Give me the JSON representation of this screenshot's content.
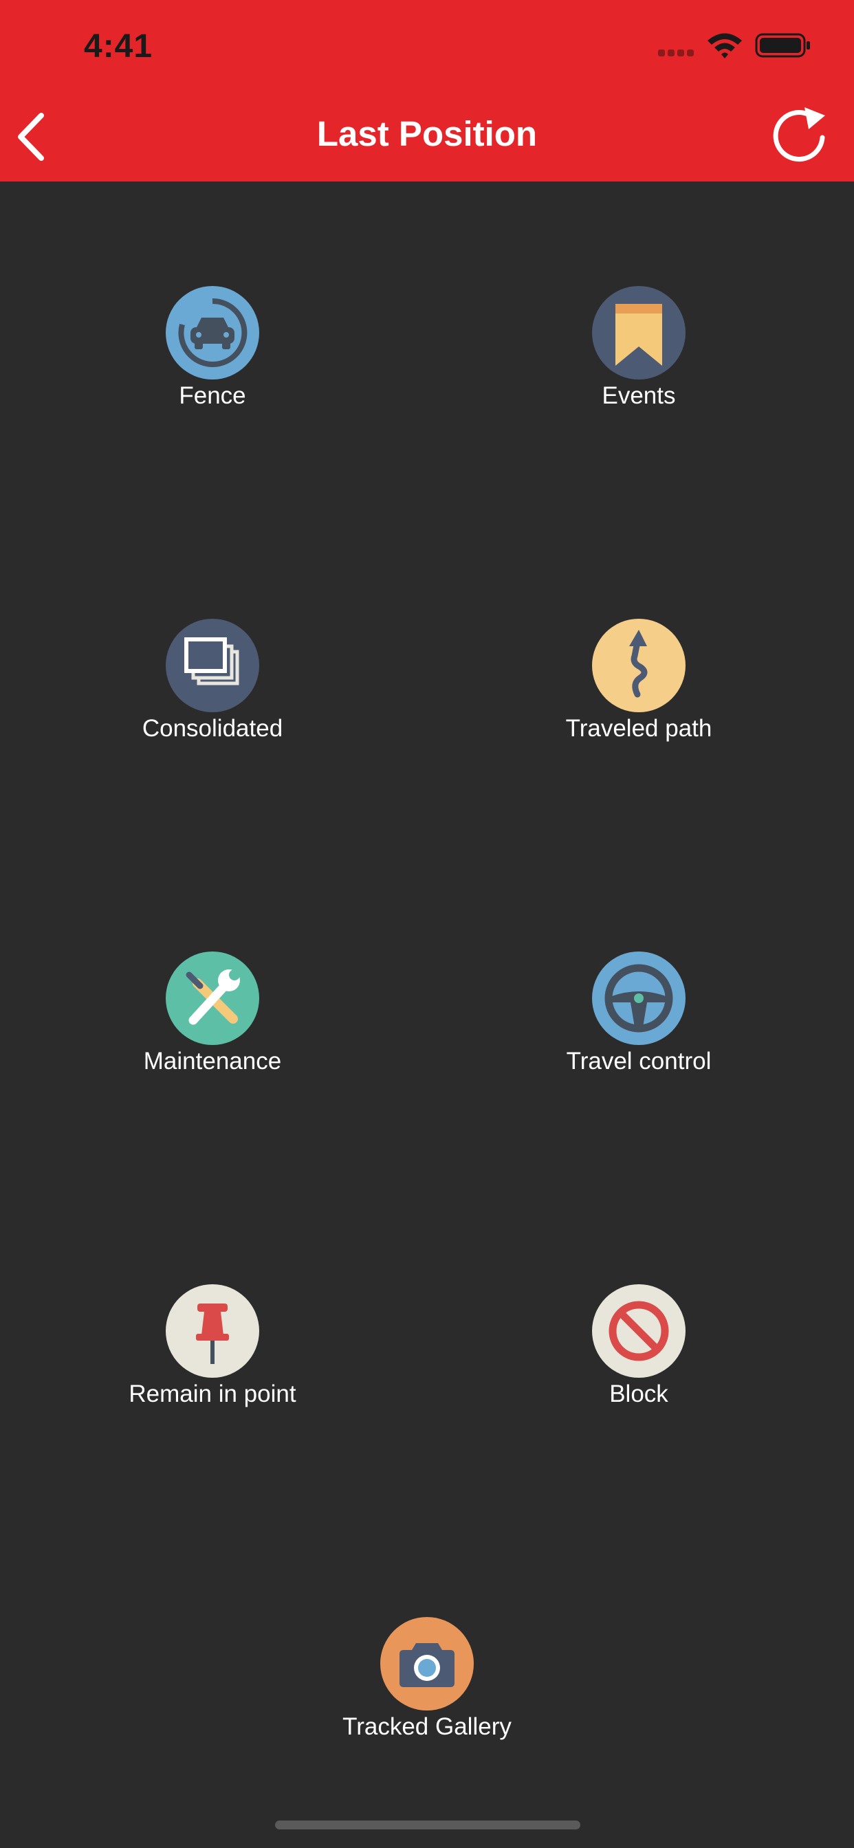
{
  "status_bar": {
    "time": "4:41"
  },
  "nav": {
    "title": "Last Position"
  },
  "menu": [
    {
      "label": "Fence",
      "icon": "car-fence-icon"
    },
    {
      "label": "Events",
      "icon": "bookmark-icon"
    },
    {
      "label": "Consolidated",
      "icon": "stacked-windows-icon"
    },
    {
      "label": "Traveled path",
      "icon": "winding-path-icon"
    },
    {
      "label": "Maintenance",
      "icon": "tools-icon"
    },
    {
      "label": "Travel control",
      "icon": "steering-wheel-icon"
    },
    {
      "label": "Remain in point",
      "icon": "push-pin-icon"
    },
    {
      "label": "Block",
      "icon": "block-icon"
    },
    {
      "label": "Tracked Gallery",
      "icon": "camera-icon"
    }
  ],
  "colors": {
    "header": "#e42529",
    "background": "#2b2b2b",
    "text": "#ffffff"
  }
}
